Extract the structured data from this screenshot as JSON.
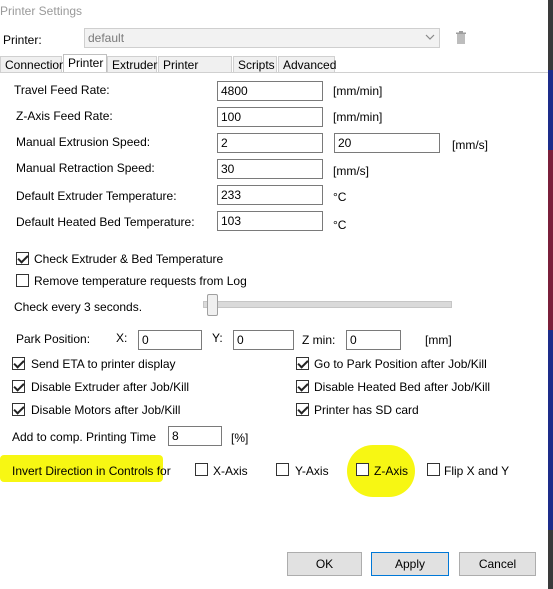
{
  "window": {
    "title": "Printer Settings"
  },
  "printer": {
    "label": "Printer:",
    "value": "default"
  },
  "tabs": [
    {
      "label": "Connection",
      "active": false
    },
    {
      "label": "Printer",
      "active": true
    },
    {
      "label": "Extruder",
      "active": false
    },
    {
      "label": "Printer Shape",
      "active": false
    },
    {
      "label": "Scripts",
      "active": false
    },
    {
      "label": "Advanced",
      "active": false
    }
  ],
  "feed": {
    "travel": {
      "label": "Travel Feed Rate:",
      "value": "4800",
      "unit": "[mm/min]"
    },
    "zaxis": {
      "label": "Z-Axis Feed Rate:",
      "value": "100",
      "unit": "[mm/min]"
    },
    "extrusion": {
      "label": "Manual Extrusion Speed:",
      "value1": "2",
      "value2": "20",
      "unit": "[mm/s]"
    },
    "retraction": {
      "label": "Manual Retraction Speed:",
      "value": "30",
      "unit": "[mm/s]"
    },
    "extruder_temp": {
      "label": "Default Extruder Temperature:",
      "value": "233",
      "unit": "°C"
    },
    "bed_temp": {
      "label": "Default Heated Bed Temperature:",
      "value": "103",
      "unit": "°C"
    }
  },
  "checks": {
    "check_temp": {
      "label": "Check Extruder & Bed Temperature",
      "checked": true
    },
    "remove_temp": {
      "label": "Remove temperature requests from Log",
      "checked": false
    }
  },
  "interval": {
    "label": "Check every 3 seconds."
  },
  "park": {
    "label": "Park Position:",
    "x_label": "X:",
    "x": "0",
    "y_label": "Y:",
    "y": "0",
    "z_label": "Z min:",
    "z": "0",
    "unit": "[mm]"
  },
  "options": {
    "send_eta": {
      "label": "Send ETA to printer display",
      "checked": true
    },
    "goto_park": {
      "label": "Go to Park Position after Job/Kill",
      "checked": true
    },
    "disable_extruder": {
      "label": "Disable Extruder after Job/Kill",
      "checked": true
    },
    "disable_bed": {
      "label": "Disable Heated Bed after Job/Kill",
      "checked": true
    },
    "disable_motors": {
      "label": "Disable Motors after Job/Kill",
      "checked": true
    },
    "sd_card": {
      "label": "Printer has SD card",
      "checked": true
    }
  },
  "comp_time": {
    "label": "Add to comp. Printing Time",
    "value": "8",
    "unit": "[%]"
  },
  "invert": {
    "label": "Invert Direction in Controls for",
    "x": {
      "label": "X-Axis",
      "checked": false
    },
    "y": {
      "label": "Y-Axis",
      "checked": false
    },
    "z": {
      "label": "Z-Axis",
      "checked": false
    },
    "flip": {
      "label": "Flip X and Y",
      "checked": false
    }
  },
  "buttons": {
    "ok": "OK",
    "apply": "Apply",
    "cancel": "Cancel"
  },
  "colors": {
    "highlight": "#f7f713",
    "accent": "#0078d7"
  }
}
